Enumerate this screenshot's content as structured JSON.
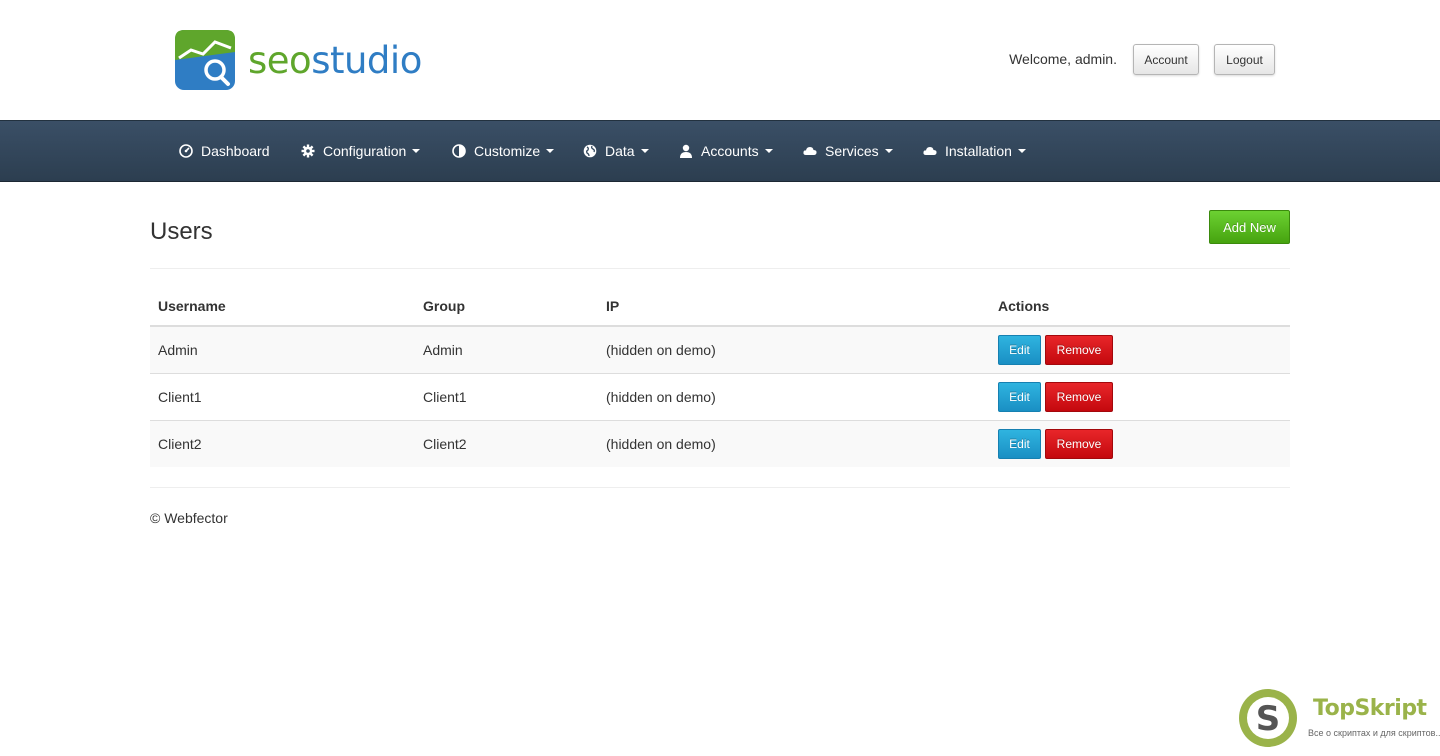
{
  "header": {
    "logo_part1": "seo",
    "logo_part2": "studio",
    "welcome": "Welcome, admin.",
    "account_label": "Account",
    "logout_label": "Logout"
  },
  "nav": {
    "items": [
      {
        "label": "Dashboard",
        "icon": "dashboard-icon",
        "dropdown": false
      },
      {
        "label": "Configuration",
        "icon": "gear-icon",
        "dropdown": true
      },
      {
        "label": "Customize",
        "icon": "contrast-icon",
        "dropdown": true
      },
      {
        "label": "Data",
        "icon": "globe-icon",
        "dropdown": true
      },
      {
        "label": "Accounts",
        "icon": "user-icon",
        "dropdown": true
      },
      {
        "label": "Services",
        "icon": "cloud-icon",
        "dropdown": true
      },
      {
        "label": "Installation",
        "icon": "cloud-icon",
        "dropdown": true
      }
    ]
  },
  "page": {
    "title": "Users",
    "add_new_label": "Add New"
  },
  "table": {
    "headers": [
      "Username",
      "Group",
      "IP",
      "Actions"
    ],
    "rows": [
      {
        "username": "Admin",
        "group": "Admin",
        "ip": "(hidden on demo)"
      },
      {
        "username": "Client1",
        "group": "Client1",
        "ip": "(hidden on demo)"
      },
      {
        "username": "Client2",
        "group": "Client2",
        "ip": "(hidden on demo)"
      }
    ],
    "edit_label": "Edit",
    "remove_label": "Remove"
  },
  "footer": {
    "text": "© Webfector"
  },
  "watermark": {
    "name": "TopSkript",
    "tagline": "Все о скриптах и для скриптов..."
  },
  "colors": {
    "navbar": "#2c3e50",
    "add_button": "#46a30f",
    "edit_button": "#1a8fc4",
    "remove_button": "#c4080e",
    "logo_green": "#5fa62c",
    "logo_blue": "#2f7dc4"
  }
}
